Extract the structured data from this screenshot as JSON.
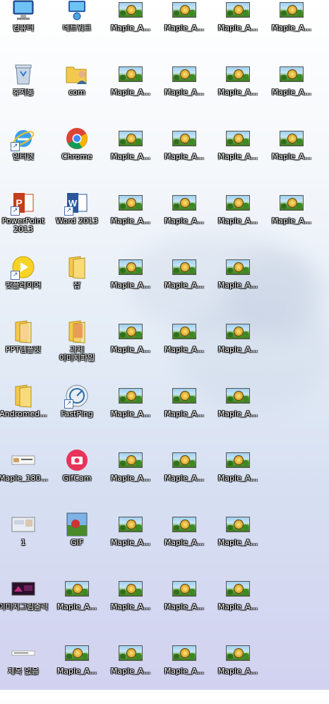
{
  "desktop": {
    "icons": [
      {
        "label": "컴퓨터",
        "kind": "computer-icon",
        "col": 0,
        "row": 0
      },
      {
        "label": "네트워크",
        "kind": "network-icon",
        "col": 1,
        "row": 0
      },
      {
        "label": "Maple_A...",
        "kind": "maple-image-icon",
        "col": 2,
        "row": 0
      },
      {
        "label": "Maple_A...",
        "kind": "maple-image-icon",
        "col": 3,
        "row": 0
      },
      {
        "label": "Maple_A...",
        "kind": "maple-image-icon",
        "col": 4,
        "row": 0
      },
      {
        "label": "Maple_A...",
        "kind": "maple-image-icon",
        "col": 5,
        "row": 0
      },
      {
        "label": "휴지통",
        "kind": "recycle-bin-icon",
        "col": 0,
        "row": 1
      },
      {
        "label": "com",
        "kind": "user-folder-icon",
        "col": 1,
        "row": 1
      },
      {
        "label": "Maple_A...",
        "kind": "maple-image-icon",
        "col": 2,
        "row": 1
      },
      {
        "label": "Maple_A...",
        "kind": "maple-image-icon",
        "col": 3,
        "row": 1
      },
      {
        "label": "Maple_A...",
        "kind": "maple-image-icon",
        "col": 4,
        "row": 1
      },
      {
        "label": "Maple_A...",
        "kind": "maple-image-icon",
        "col": 5,
        "row": 1
      },
      {
        "label": "인터넷",
        "kind": "internet-explorer-icon",
        "col": 0,
        "row": 2,
        "shortcut": true
      },
      {
        "label": "Chrome",
        "kind": "chrome-icon",
        "col": 1,
        "row": 2
      },
      {
        "label": "Maple_A...",
        "kind": "maple-image-icon",
        "col": 2,
        "row": 2
      },
      {
        "label": "Maple_A...",
        "kind": "maple-image-icon",
        "col": 3,
        "row": 2
      },
      {
        "label": "Maple_A...",
        "kind": "maple-image-icon",
        "col": 4,
        "row": 2
      },
      {
        "label": "Maple_A...",
        "kind": "maple-image-icon",
        "col": 5,
        "row": 2
      },
      {
        "label": "PowerPoint\n2013",
        "kind": "powerpoint-icon",
        "col": 0,
        "row": 3,
        "shortcut": true
      },
      {
        "label": "Word 2013",
        "kind": "word-icon",
        "col": 1,
        "row": 3,
        "shortcut": true
      },
      {
        "label": "Maple_A...",
        "kind": "maple-image-icon",
        "col": 2,
        "row": 3
      },
      {
        "label": "Maple_A...",
        "kind": "maple-image-icon",
        "col": 3,
        "row": 3
      },
      {
        "label": "Maple_A...",
        "kind": "maple-image-icon",
        "col": 4,
        "row": 3
      },
      {
        "label": "Maple_A...",
        "kind": "maple-image-icon",
        "col": 5,
        "row": 3
      },
      {
        "label": "팟플레이어",
        "kind": "potplayer-icon",
        "col": 0,
        "row": 4,
        "shortcut": true
      },
      {
        "label": "잡",
        "kind": "folder-icon",
        "col": 1,
        "row": 4
      },
      {
        "label": "Maple_A...",
        "kind": "maple-image-icon",
        "col": 2,
        "row": 4
      },
      {
        "label": "Maple_A...",
        "kind": "maple-image-icon",
        "col": 3,
        "row": 4
      },
      {
        "label": "Maple_A...",
        "kind": "maple-image-icon",
        "col": 4,
        "row": 4
      },
      {
        "label": "PPT템플릿",
        "kind": "ppt-template-folder-icon",
        "col": 0,
        "row": 5
      },
      {
        "label": "과제\n이미지파일",
        "kind": "image-folder-icon",
        "col": 1,
        "row": 5
      },
      {
        "label": "Maple_A...",
        "kind": "maple-image-icon",
        "col": 2,
        "row": 5
      },
      {
        "label": "Maple_A...",
        "kind": "maple-image-icon",
        "col": 3,
        "row": 5
      },
      {
        "label": "Maple_A...",
        "kind": "maple-image-icon",
        "col": 4,
        "row": 5
      },
      {
        "label": "Andromed...",
        "kind": "folder-icon",
        "col": 0,
        "row": 6
      },
      {
        "label": "FastPing",
        "kind": "fastping-icon",
        "col": 1,
        "row": 6,
        "shortcut": true
      },
      {
        "label": "Maple_A...",
        "kind": "maple-image-icon",
        "col": 2,
        "row": 6
      },
      {
        "label": "Maple_A...",
        "kind": "maple-image-icon",
        "col": 3,
        "row": 6
      },
      {
        "label": "Maple_A...",
        "kind": "maple-image-icon",
        "col": 4,
        "row": 6
      },
      {
        "label": "Maple_180...",
        "kind": "maple-screenshot-icon",
        "col": 0,
        "row": 7
      },
      {
        "label": "GifCam",
        "kind": "gifcam-icon",
        "col": 1,
        "row": 7
      },
      {
        "label": "Maple_A...",
        "kind": "maple-image-icon",
        "col": 2,
        "row": 7
      },
      {
        "label": "Maple_A...",
        "kind": "maple-image-icon",
        "col": 3,
        "row": 7
      },
      {
        "label": "Maple_A...",
        "kind": "maple-image-icon",
        "col": 4,
        "row": 7
      },
      {
        "label": "1",
        "kind": "image-file-icon",
        "col": 0,
        "row": 8
      },
      {
        "label": "GIF",
        "kind": "gif-file-icon",
        "col": 1,
        "row": 8
      },
      {
        "label": "Maple_A...",
        "kind": "maple-image-icon",
        "col": 2,
        "row": 8
      },
      {
        "label": "Maple_A...",
        "kind": "maple-image-icon",
        "col": 3,
        "row": 8
      },
      {
        "label": "Maple_A...",
        "kind": "maple-image-icon",
        "col": 4,
        "row": 8
      },
      {
        "label": "이미지그림출력",
        "kind": "image-print-icon",
        "col": 0,
        "row": 9
      },
      {
        "label": "Maple_A...",
        "kind": "maple-image-icon",
        "col": 1,
        "row": 9
      },
      {
        "label": "Maple_A...",
        "kind": "maple-image-icon",
        "col": 2,
        "row": 9
      },
      {
        "label": "Maple_A...",
        "kind": "maple-image-icon",
        "col": 3,
        "row": 9
      },
      {
        "label": "Maple_A...",
        "kind": "maple-image-icon",
        "col": 4,
        "row": 9
      },
      {
        "label": "제목 없음",
        "kind": "text-file-icon",
        "col": 0,
        "row": 10
      },
      {
        "label": "Maple_A...",
        "kind": "maple-image-icon",
        "col": 1,
        "row": 10
      },
      {
        "label": "Maple_A...",
        "kind": "maple-image-icon",
        "col": 2,
        "row": 10
      },
      {
        "label": "Maple_A...",
        "kind": "maple-image-icon",
        "col": 3,
        "row": 10
      },
      {
        "label": "Maple_A...",
        "kind": "maple-image-icon",
        "col": 4,
        "row": 10
      }
    ]
  }
}
